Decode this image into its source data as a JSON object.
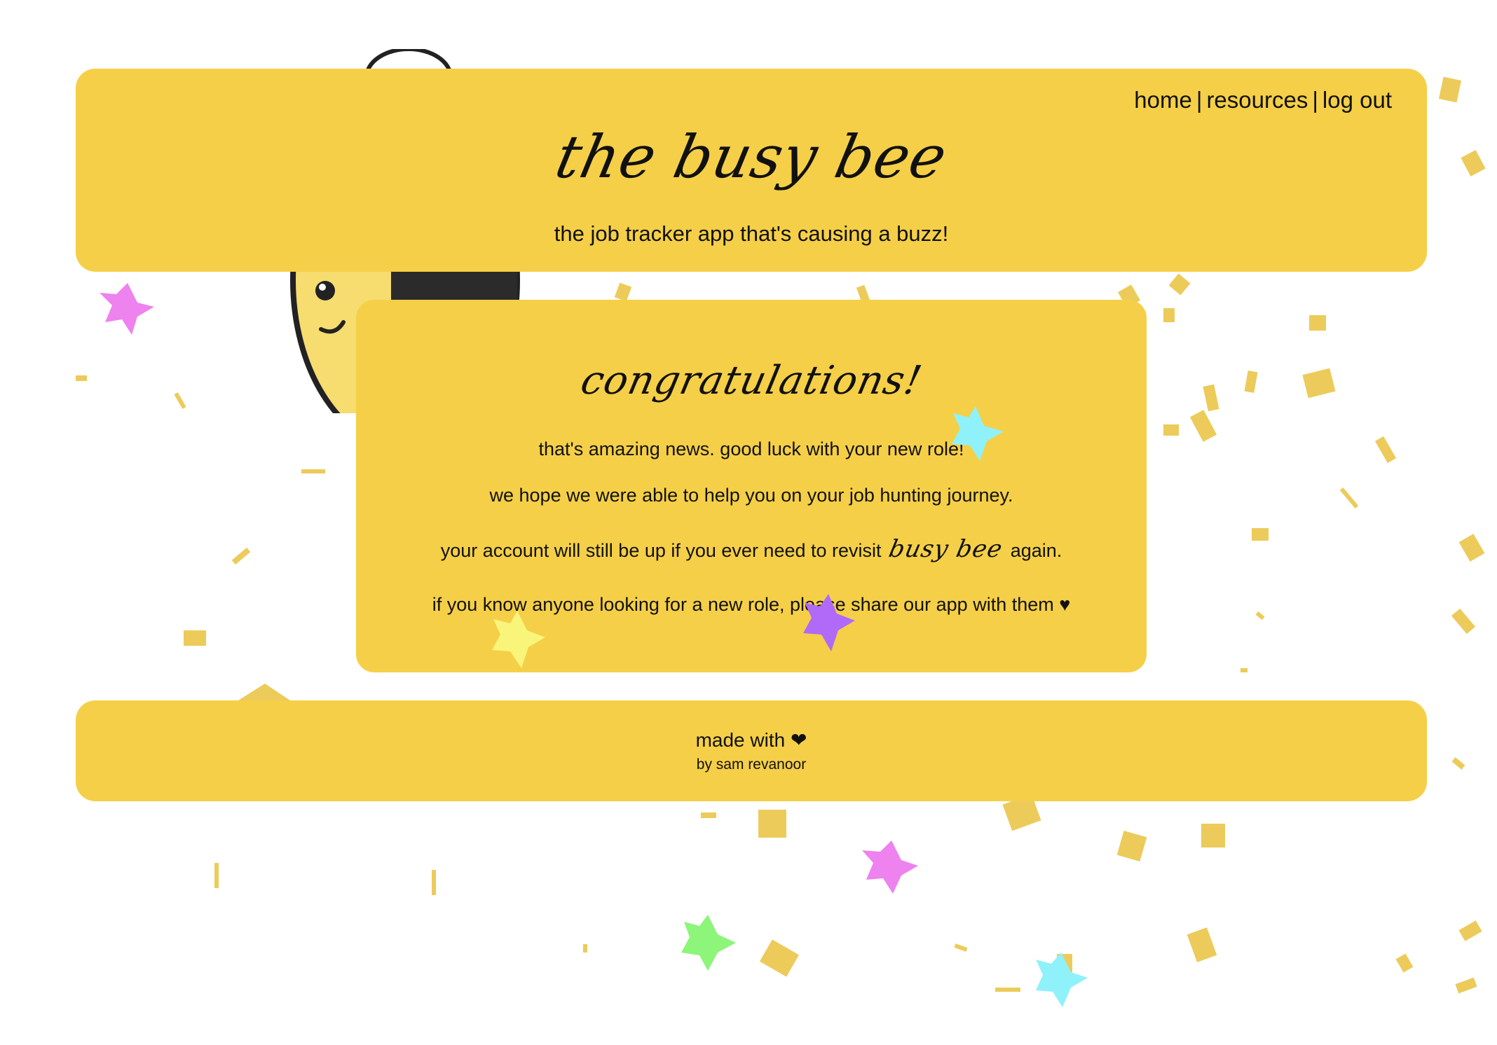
{
  "nav": {
    "home": "home",
    "resources": "resources",
    "logout": "log out",
    "separator": "|"
  },
  "header": {
    "title": "the busy bee",
    "tagline": "the job tracker app that's causing a buzz!"
  },
  "main": {
    "heading": "congratulations!",
    "line1": "that's amazing news. good luck with your new role!",
    "line2": "we hope we were able to help you on your job hunting journey.",
    "line3_before": "your account will still be up if you ever need to revisit",
    "line3_brand": "busy bee",
    "line3_after": "again.",
    "line4": "if you know anyone looking for a new role, please share our app with them ♥"
  },
  "footer": {
    "made_with": "made with ❤",
    "by": "by sam revanoor"
  },
  "colors": {
    "panel": "#f5cf47",
    "confetti": "#e9c23d",
    "star_pink": "#ee82ee",
    "star_cyan": "#8ff2fa",
    "star_purple": "#b06af7",
    "star_green": "#8cf57a",
    "star_yellow": "#f9f57a"
  }
}
